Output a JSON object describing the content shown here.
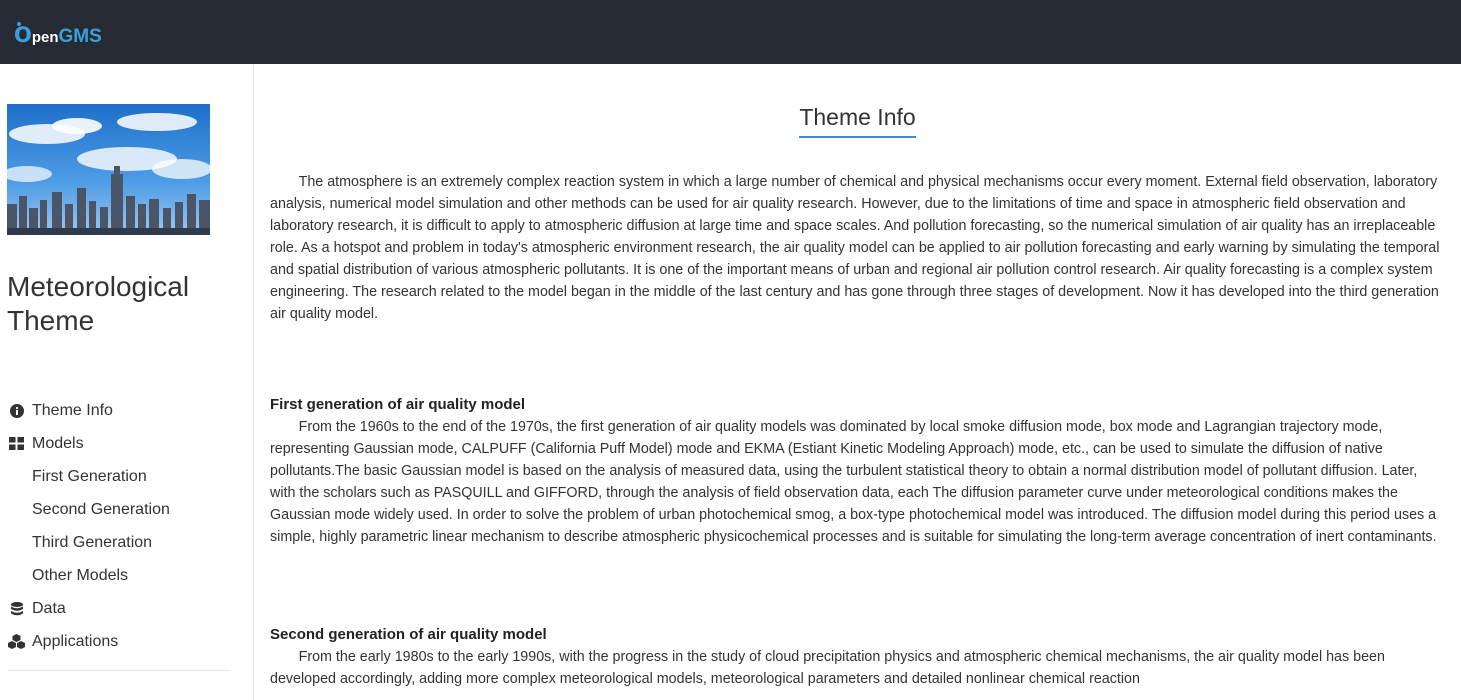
{
  "header": {
    "logo_o": "O",
    "logo_pen": "pen",
    "logo_gms": "GMS",
    "colors": {
      "background": "#262a33",
      "accent": "#3aa0dc"
    }
  },
  "sidebar": {
    "image_icon": "city-skyline-photo",
    "theme_title": "Meteorological Theme",
    "nav": [
      {
        "label": "Theme Info",
        "icon": "info-circle-icon",
        "level": "top"
      },
      {
        "label": "Models",
        "icon": "grid-icon",
        "level": "top"
      },
      {
        "label": "First Generation",
        "level": "sub"
      },
      {
        "label": "Second Generation",
        "level": "sub"
      },
      {
        "label": "Third Generation",
        "level": "sub"
      },
      {
        "label": "Other Models",
        "level": "sub"
      },
      {
        "label": "Data",
        "icon": "database-icon",
        "level": "top"
      },
      {
        "label": "Applications",
        "icon": "cubes-icon",
        "level": "top"
      }
    ]
  },
  "main": {
    "title": "Theme Info",
    "title_underline_color": "#3a8be0",
    "intro": "The atmosphere is an extremely complex reaction system in which a large number of chemical and physical mechanisms occur every moment. External field observation, laboratory analysis, numerical model simulation and other methods can be used for air quality research. However, due to the limitations of time and space in atmospheric field observation and laboratory research, it is difficult to apply to atmospheric diffusion at large time and space scales. And pollution forecasting, so the numerical simulation of air quality has an irreplaceable role. As a hotspot and problem in today's atmospheric environment research, the air quality model can be applied to air pollution forecasting and early warning by simulating the temporal and spatial distribution of various atmospheric pollutants. It is one of the important means of urban and regional air pollution control research. Air quality forecasting is a complex system engineering. The research related to the model began in the middle of the last century and has gone through three stages of development. Now it has developed into the third generation air quality model.",
    "sections": [
      {
        "heading": "First generation of air quality model",
        "text": "From the 1960s to the end of the 1970s, the first generation of air quality models was dominated by local smoke diffusion mode, box mode and Lagrangian trajectory mode, representing Gaussian mode, CALPUFF (California Puff Model) mode and EKMA (Estiant Kinetic Modeling Approach) mode, etc., can be used to simulate the diffusion of native pollutants.The basic Gaussian model is based on the analysis of measured data, using the turbulent statistical theory to obtain a normal distribution model of pollutant diffusion. Later, with the scholars such as PASQUILL and GIFFORD, through the analysis of field observation data, each The diffusion parameter curve under meteorological conditions makes the Gaussian mode widely used. In order to solve the problem of urban photochemical smog, a box-type photochemical model was introduced. The diffusion model during this period uses a simple, highly parametric linear mechanism to describe atmospheric physicochemical processes and is suitable for simulating the long-term average concentration of inert contaminants."
      },
      {
        "heading": "Second generation of air quality model",
        "text": "From the early 1980s to the early 1990s, with the progress in the study of cloud precipitation physics and atmospheric chemical mechanisms, the air quality model has been developed accordingly, adding more complex meteorological models, meteorological parameters and detailed nonlinear chemical reaction"
      }
    ]
  }
}
